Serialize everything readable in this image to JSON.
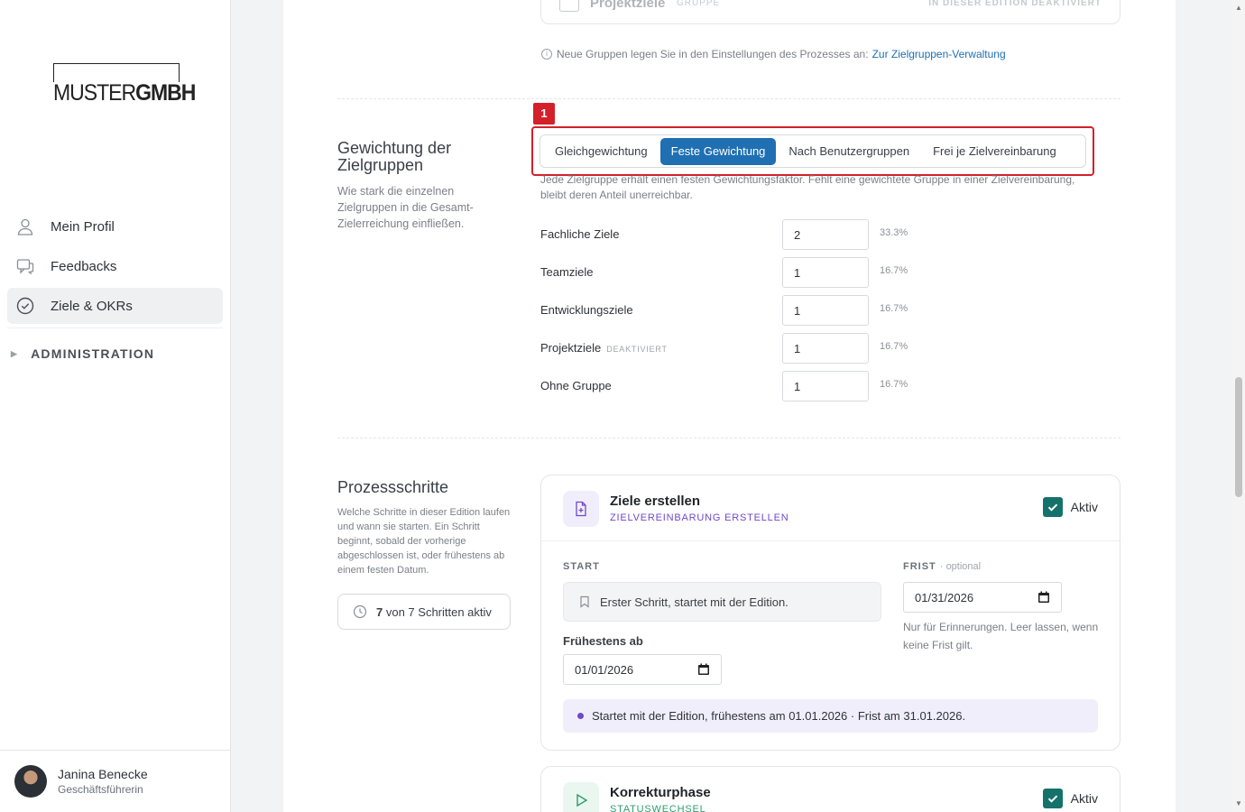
{
  "sidebar": {
    "logo": {
      "light": "MUSTER",
      "bold": "GMBH"
    },
    "nav": [
      {
        "label": "Mein Profil",
        "icon": "user-icon"
      },
      {
        "label": "Feedbacks",
        "icon": "chat-icon"
      },
      {
        "label": "Ziele & OKRs",
        "icon": "check-circle-icon",
        "active": true
      }
    ],
    "admin_label": "ADMINISTRATION",
    "user": {
      "name": "Janina Benecke",
      "role": "Geschäftsführerin"
    }
  },
  "groups_card": {
    "title": "Projektziele",
    "tag": "GRUPPE",
    "edition_note": "IN DIESER EDITION DEAKTIVIERT"
  },
  "groups_hint": {
    "text": "Neue Gruppen legen Sie in den Einstellungen des Prozesses an:",
    "link": "Zur Zielgruppen-Verwaltung"
  },
  "weighting": {
    "title": "Gewichtung der Zielgruppen",
    "description": "Wie stark die einzelnen Zielgruppen in die Gesamt-Zielerreichung einfließen.",
    "badge": "1",
    "options": [
      "Gleichgewichtung",
      "Feste Gewichtung",
      "Nach Benutzergruppen",
      "Frei je Zielvereinbarung"
    ],
    "selected": "Feste Gewichtung",
    "explanation": "Jede Zielgruppe erhält einen festen Gewichtungsfaktor. Fehlt eine gewichtete Gruppe in einer Zielvereinbarung, bleibt deren Anteil unerreichbar.",
    "rows": [
      {
        "label": "Fachliche Ziele",
        "tag": "",
        "value": "2",
        "percent": "33.3%"
      },
      {
        "label": "Teamziele",
        "tag": "",
        "value": "1",
        "percent": "16.7%"
      },
      {
        "label": "Entwicklungsziele",
        "tag": "",
        "value": "1",
        "percent": "16.7%"
      },
      {
        "label": "Projektziele",
        "tag": "DEAKTIVIERT",
        "value": "1",
        "percent": "16.7%"
      },
      {
        "label": "Ohne Gruppe",
        "tag": "",
        "value": "1",
        "percent": "16.7%"
      }
    ]
  },
  "process": {
    "title": "Prozessschritte",
    "description": "Welche Schritte in dieser Edition laufen und wann sie starten. Ein Schritt beginnt, sobald der vorherige abgeschlossen ist, oder frühestens ab einem festen Datum.",
    "active_count": "7",
    "active_count_rest": "von 7 Schritten aktiv",
    "steps": [
      {
        "title": "Ziele erstellen",
        "subtitle": "ZIELVEREINBARUNG ERSTELLEN",
        "color": "#7048c8",
        "active_label": "Aktiv",
        "start_label": "START",
        "start_text": "Erster Schritt, startet mit der Edition.",
        "frist_label": "FRIST",
        "frist_optional": "· optional",
        "frist_value": "01/31/2026",
        "frist_note": "Nur für Erinnerungen. Leer lassen, wenn keine Frist gilt.",
        "earliest_label": "Frühestens ab",
        "earliest_value": "01/01/2026",
        "summary": "Startet mit der Edition, frühestens am 01.01.2026 · Frist am 31.01.2026."
      },
      {
        "title": "Korrekturphase",
        "subtitle": "STATUSWECHSEL",
        "color": "#2e9c6c",
        "active_label": "Aktiv"
      }
    ]
  }
}
